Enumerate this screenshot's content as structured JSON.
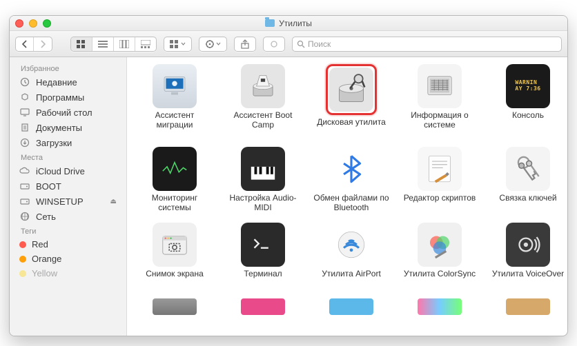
{
  "window": {
    "title": "Утилиты"
  },
  "search": {
    "placeholder": "Поиск"
  },
  "sidebar": {
    "sections": [
      {
        "title": "Избранное",
        "items": [
          {
            "icon": "clock",
            "label": "Недавние"
          },
          {
            "icon": "apps",
            "label": "Программы"
          },
          {
            "icon": "desktop",
            "label": "Рабочий стол"
          },
          {
            "icon": "docs",
            "label": "Документы"
          },
          {
            "icon": "downloads",
            "label": "Загрузки"
          }
        ]
      },
      {
        "title": "Места",
        "items": [
          {
            "icon": "icloud",
            "label": "iCloud Drive"
          },
          {
            "icon": "disk",
            "label": "BOOT"
          },
          {
            "icon": "disk",
            "label": "WINSETUP",
            "eject": true
          },
          {
            "icon": "globe",
            "label": "Сеть"
          }
        ]
      },
      {
        "title": "Теги",
        "items": [
          {
            "icon": "tag",
            "color": "#ff5b4f",
            "label": "Red"
          },
          {
            "icon": "tag",
            "color": "#ff9f0a",
            "label": "Orange"
          },
          {
            "icon": "tag",
            "color": "#ffd60a",
            "label": "Yellow"
          }
        ]
      }
    ]
  },
  "apps": [
    {
      "name": "migration",
      "label": "Ассистент миграции"
    },
    {
      "name": "bootcamp",
      "label": "Ассистент Boot Camp"
    },
    {
      "name": "diskutility",
      "label": "Дисковая утилита",
      "highlighted": true
    },
    {
      "name": "sysinfo",
      "label": "Информация о системе"
    },
    {
      "name": "console",
      "label": "Консоль",
      "console_text": "WARNIN\nAY 7:36"
    },
    {
      "name": "activity",
      "label": "Мониторинг системы"
    },
    {
      "name": "audiomidi",
      "label": "Настройка Audio-MIDI"
    },
    {
      "name": "bluetooth",
      "label": "Обмен файлами по Bluetooth"
    },
    {
      "name": "scripteditor",
      "label": "Редактор скриптов"
    },
    {
      "name": "keychain",
      "label": "Связка ключей"
    },
    {
      "name": "screenshot",
      "label": "Снимок экрана"
    },
    {
      "name": "terminal",
      "label": "Терминал"
    },
    {
      "name": "airport",
      "label": "Утилита AirPort"
    },
    {
      "name": "colorsync",
      "label": "Утилита ColorSync"
    },
    {
      "name": "voiceover",
      "label": "Утилита VoiceOver"
    }
  ]
}
